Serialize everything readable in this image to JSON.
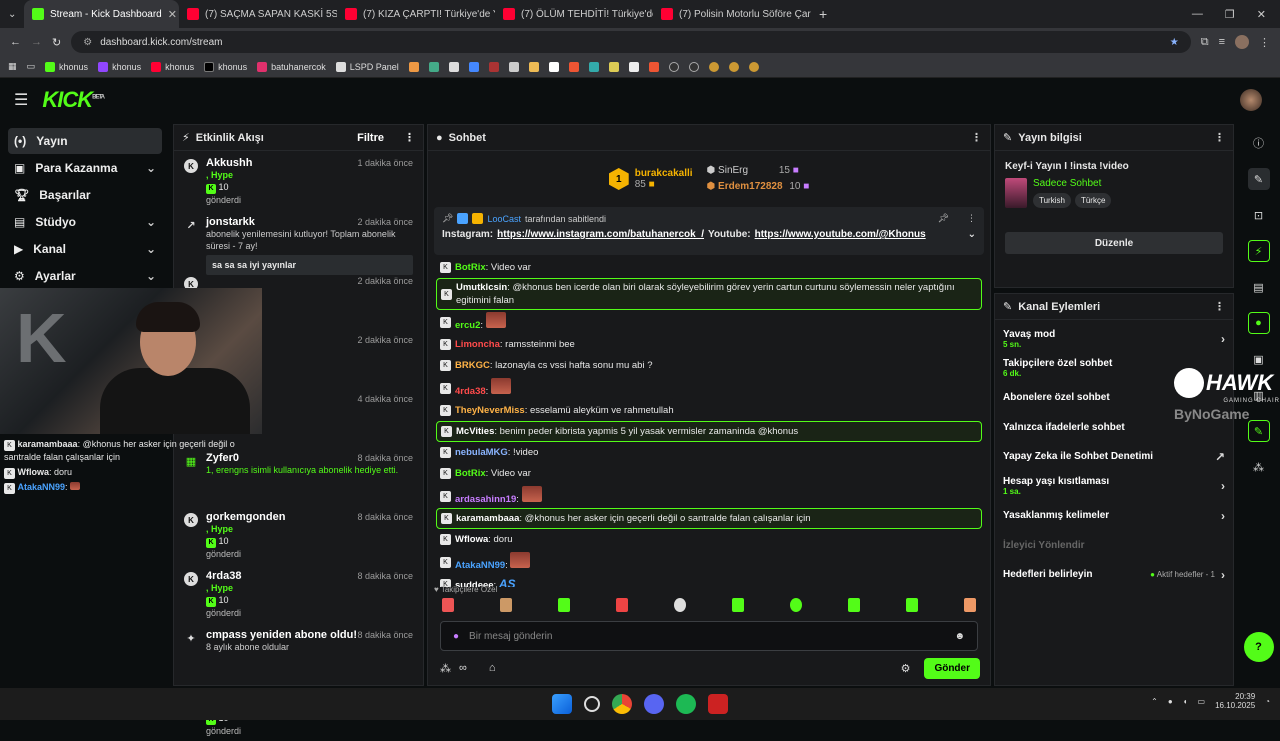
{
  "browser": {
    "tabs": [
      {
        "title": "Stream - Kick Dashboard",
        "color": "#53fc18",
        "active": true
      },
      {
        "title": "(7) SAÇMA SAPAN KASKİ 5Srİde",
        "color": "#ff0033"
      },
      {
        "title": "(7) KIZA ÇARPTI! Türkiye'de Yaş",
        "color": "#ff0033"
      },
      {
        "title": "(7) ÖLÜM TEHDİTİ! Türkiye'de Y",
        "color": "#ff0033"
      },
      {
        "title": "(7) Polisin Motorlu Söföre Çarpı",
        "color": "#ff0033"
      }
    ],
    "url": "dashboard.kick.com/stream",
    "bookmarks": [
      "khonus",
      "khonus",
      "khonus",
      "khonus",
      "batuhanercok",
      "LSPD Panel"
    ]
  },
  "header": {
    "logo": "KICK",
    "logo_tag": "BETA"
  },
  "sidebar": {
    "items": [
      {
        "label": "Yayın"
      },
      {
        "label": "Para Kazanma"
      },
      {
        "label": "Başarılar"
      },
      {
        "label": "Stüdyo"
      },
      {
        "label": "Kanal"
      },
      {
        "label": "Ayarlar"
      }
    ]
  },
  "overlay_chat": [
    {
      "user": "karamambaaa",
      "text": ": @khonus her asker için geçerli değil o santralde falan çalışanlar için"
    },
    {
      "user": "Wflowa",
      "text": ": doru"
    },
    {
      "user": "AtakaNN99",
      "text": ":"
    }
  ],
  "events": {
    "title": "Etkinlik Akışı",
    "filter": "Filtre",
    "items": [
      {
        "name": "Akkushh",
        "time": "1 dakika önce",
        "l1": ", Hype",
        "l2": "10",
        "l3": "gönderdi"
      },
      {
        "name": "jonstarkk",
        "time": "2 dakika önce",
        "l1": "abonelik yenilemesini kutluyor! Toplam abonelik süresi - 7 ay!",
        "l2": "sa sa sa iyi yayınlar",
        "l3": ""
      },
      {
        "name": "",
        "time": "2 dakika önce",
        "l1": "",
        "l2": "",
        "l3": ""
      },
      {
        "name": "",
        "time": "2 dakika önce",
        "l1": "",
        "l2": "",
        "l3": ""
      },
      {
        "name": "",
        "time": "4 dakika önce",
        "l1": "",
        "l2": "",
        "l3": ""
      },
      {
        "name": "Zyfer0",
        "time": "8 dakika önce",
        "l1": "1, erengns isimli kullanıcıya abonelik hediye etti.",
        "l2": "",
        "l3": ""
      },
      {
        "name": "gorkemgonden",
        "time": "8 dakika önce",
        "l1": ", Hype",
        "l2": "10",
        "l3": "gönderdi"
      },
      {
        "name": "4rda38",
        "time": "8 dakika önce",
        "l1": ", Hype",
        "l2": "10",
        "l3": "gönderdi"
      },
      {
        "name": "cmpass yeniden abone oldu!",
        "time": "8 dakika önce",
        "l1": "8 aylık abone oldular",
        "l2": "",
        "l3": ""
      },
      {
        "name": "4rda38",
        "time": "13 dakika önce",
        "l1": ", Hype",
        "l2": "10",
        "l3": "gönderdi"
      }
    ]
  },
  "chat": {
    "title": "Sohbet",
    "leaders": [
      {
        "rank": "1",
        "name": "burakcakalli",
        "score": "85"
      },
      {
        "name": "SinErg",
        "score": "15"
      },
      {
        "name": "Erdem172828",
        "score": "10"
      }
    ],
    "pinned_by": "LooCast",
    "pinned_by_suffix": "tarafından sabitlendi",
    "pinned_prefix": "Instagram:",
    "pinned_link1": "https://www.instagram.com/batuhanercok_/",
    "pinned_mid": "Youtube:",
    "pinned_link2": "https://www.youtube.com/@Khonus",
    "messages": [
      {
        "user": "BotRix",
        "color": "#53fc18",
        "text": ": Video var",
        "hl": false
      },
      {
        "user": "Umutklcsin",
        "color": "#ffffff",
        "text": ": @khonus ben icerde olan biri olarak söyleyebilirim görev yerin cartun curtunu söylemessin neler yaptığını egitimini falan",
        "hl": true
      },
      {
        "user": "ercu2",
        "color": "#53fc18",
        "text": ":",
        "hl": false,
        "emote": true
      },
      {
        "user": "Limoncha",
        "color": "#ff4b4b",
        "text": ": ramssteinmi bee",
        "hl": false
      },
      {
        "user": "BRKGC",
        "color": "#ffb347",
        "text": ": lazonayla cs vssi hafta sonu mu abi ?",
        "hl": false
      },
      {
        "user": "4rda38",
        "color": "#ff4b4b",
        "text": ":",
        "hl": false,
        "emote": true
      },
      {
        "user": "TheyNeverMiss",
        "color": "#ffb347",
        "text": ": esselamü aleyküm ve rahmetullah",
        "hl": false
      },
      {
        "user": "McVities",
        "color": "#ffffff",
        "text": ": benim peder kibrista yapmis 5 yil yasak vermisler zamaninda @khonus",
        "hl": true
      },
      {
        "user": "nebulaMKG",
        "color": "#8ab4ff",
        "text": ": !video",
        "hl": false
      },
      {
        "user": "BotRix",
        "color": "#53fc18",
        "text": ": Video var",
        "hl": false
      },
      {
        "user": "ardasahinn19",
        "color": "#c77dff",
        "text": ":",
        "hl": false,
        "emote": true
      },
      {
        "user": "karamambaaa",
        "color": "#ffffff",
        "text": ": @khonus her asker için geçerli değil o santralde falan çalışanlar için",
        "hl": true
      },
      {
        "user": "Wflowa",
        "color": "#ffffff",
        "text": ": doru",
        "hl": false
      },
      {
        "user": "AtakaNN99",
        "color": "#4aa3ff",
        "text": ":",
        "hl": false,
        "emote": true
      },
      {
        "user": "suddeee",
        "color": "#ffffff",
        "text": ":",
        "hl": false,
        "as": "AS"
      }
    ],
    "emote_label": "Takipçilere Özel",
    "input_placeholder": "Bir mesaj gönderin",
    "send": "Gönder"
  },
  "info": {
    "title": "Yayın bilgisi",
    "stream_title": "Keyf-i Yayın I !insta !video",
    "category": "Sadece Sohbet",
    "tags": [
      "Turkish",
      "Türkçe"
    ],
    "edit": "Düzenle"
  },
  "actions": {
    "title": "Kanal Eylemleri",
    "items": [
      {
        "label": "Yavaş mod",
        "sub": "5 sn.",
        "arrow": "›"
      },
      {
        "label": "Takipçilere özel sohbet",
        "sub": "6 dk.",
        "arrow": ""
      },
      {
        "label": "Abonelere özel sohbet",
        "sub": "",
        "arrow": ""
      },
      {
        "label": "Yalnızca ifadelerle sohbet",
        "sub": "",
        "arrow": ""
      },
      {
        "label": "Yapay Zeka ile Sohbet Denetimi",
        "sub": "",
        "arrow": "↗"
      },
      {
        "label": "Hesap yaşı kısıtlaması",
        "sub": "1 sa.",
        "arrow": "›"
      },
      {
        "label": "Yasaklanmış kelimeler",
        "sub": "",
        "arrow": "›"
      },
      {
        "label": "İzleyici Yönlendir",
        "sub": "",
        "arrow": "",
        "dim": true
      },
      {
        "label": "Hedefleri belirleyin",
        "sub": "",
        "arrow": "›",
        "extra": "Aktif hedefler - 1"
      }
    ]
  },
  "watermark": {
    "brand": "HAWK",
    "sub": "GAMING CHAIR",
    "sponsor": "ByNoGame"
  },
  "clock": {
    "time": "20:39",
    "date": "16.10.2025"
  },
  "colors": {
    "kick_green": "#53fc18",
    "panel": "#18191b",
    "bg": "#0b0e0f"
  }
}
